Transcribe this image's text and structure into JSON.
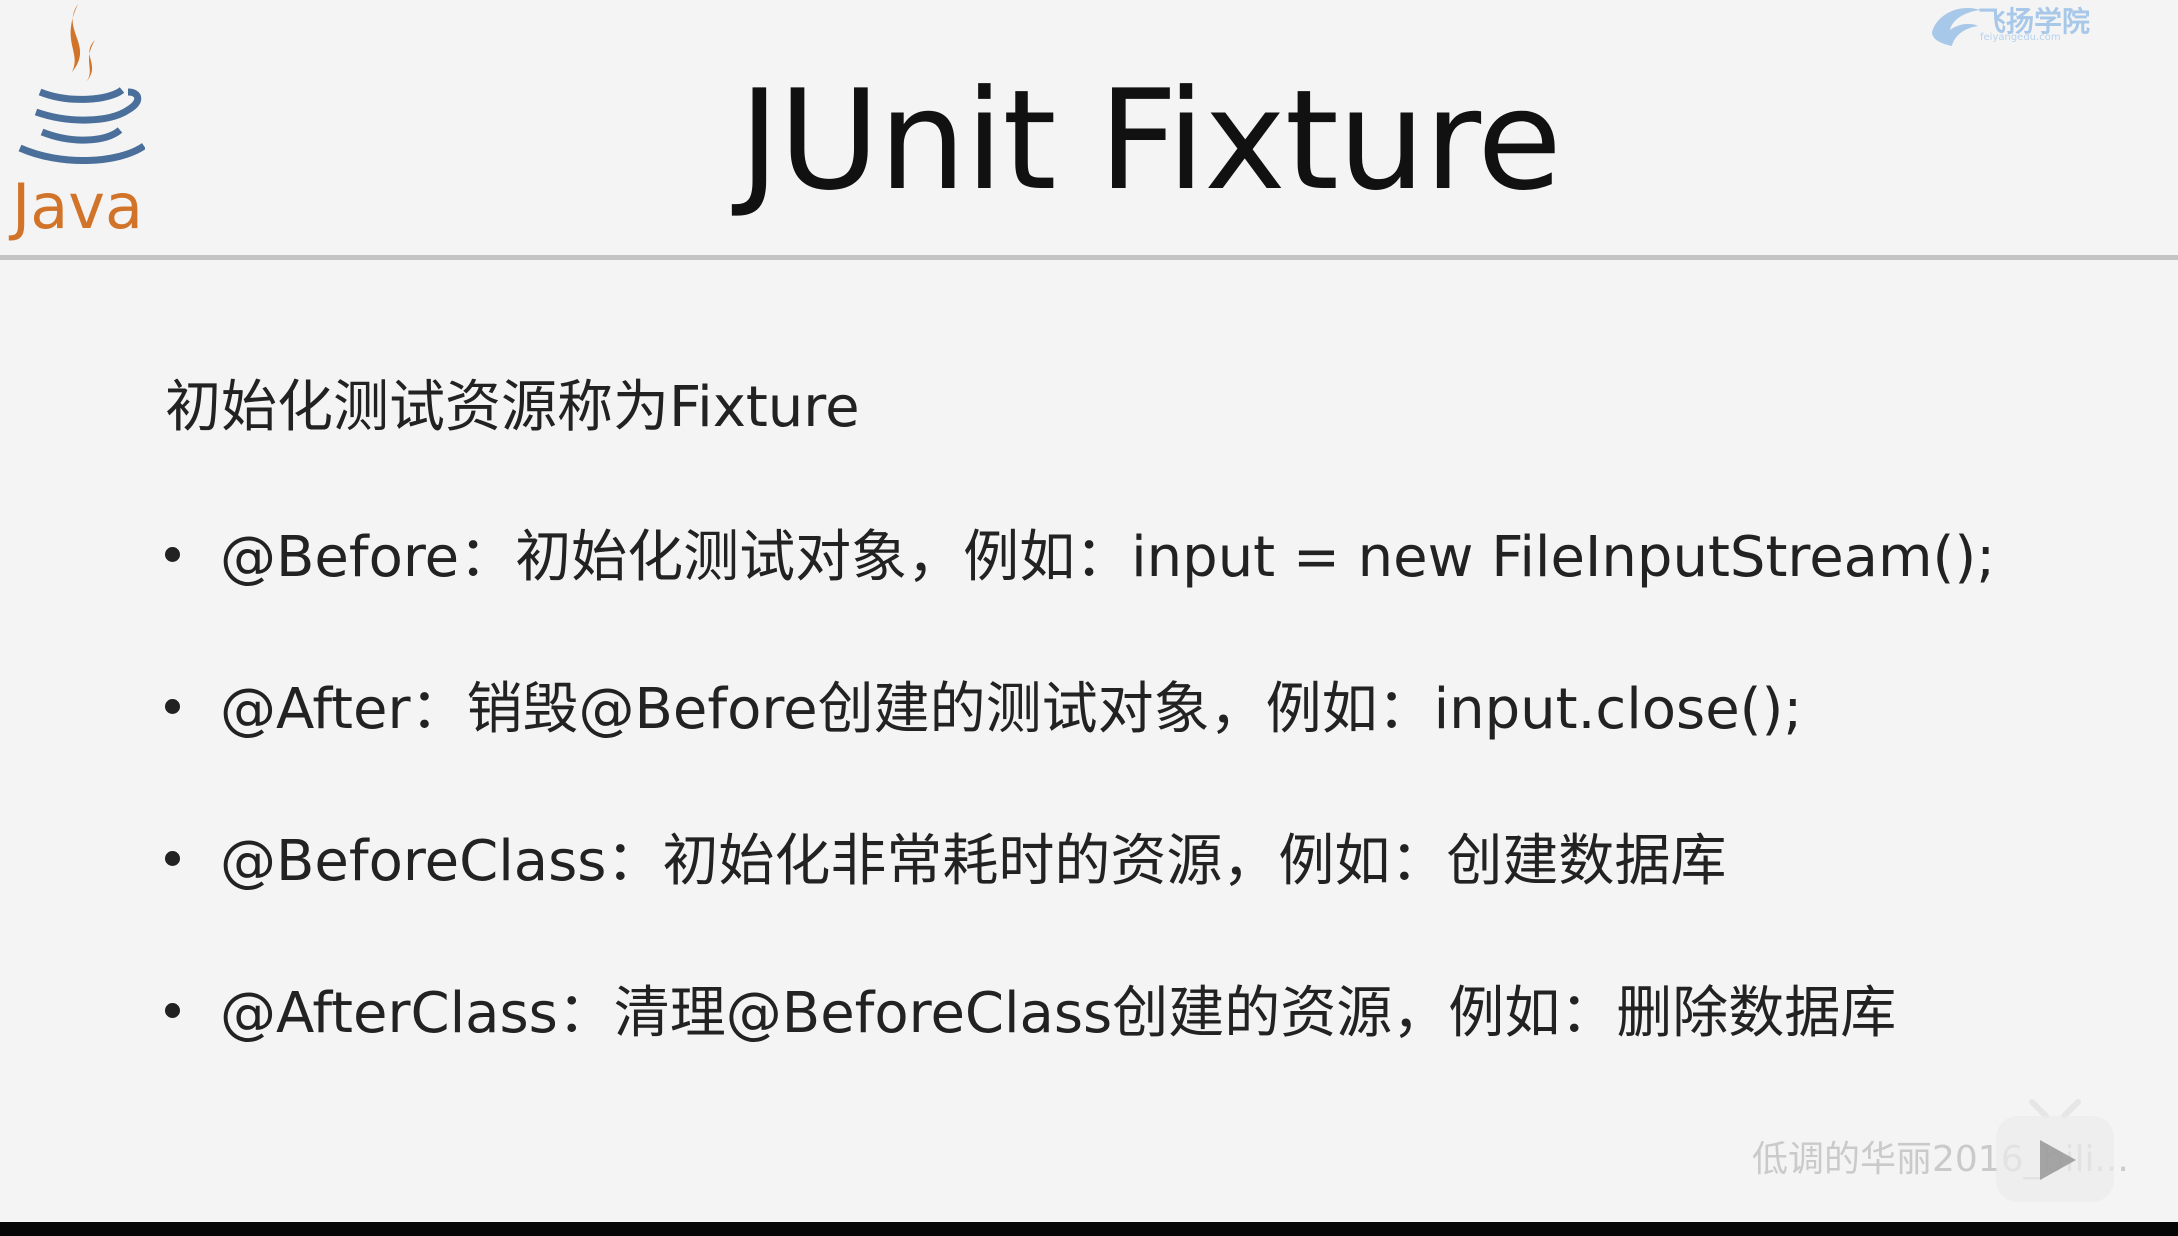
{
  "slide": {
    "title": "JUnit Fixture",
    "logo_text": "Java",
    "brand_text": "飞扬学院",
    "brand_sub": "feiyangedu.com",
    "intro": "初始化测试资源称为Fixture",
    "bullets": [
      {
        "text": "@Before：初始化测试对象，例如：input = new FileInputStream();"
      },
      {
        "text": "@After：销毁@Before创建的测试对象，例如：input.close();"
      },
      {
        "text": "@BeforeClass：初始化非常耗时的资源，例如：创建数据库"
      },
      {
        "text": "@AfterClass：清理@BeforeClass创建的资源，例如：删除数据库"
      }
    ]
  },
  "overlay": {
    "watermark": "低调的华丽2016_bili..."
  },
  "colors": {
    "background": "#f4f4f4",
    "java_orange": "#d1742a",
    "java_blue": "#4a6f9a",
    "brand_blue": "#a8c8ea"
  },
  "icons": {
    "java_logo": "coffee-cup-icon",
    "brand_logo": "bird-wing-icon",
    "play": "play-icon"
  }
}
